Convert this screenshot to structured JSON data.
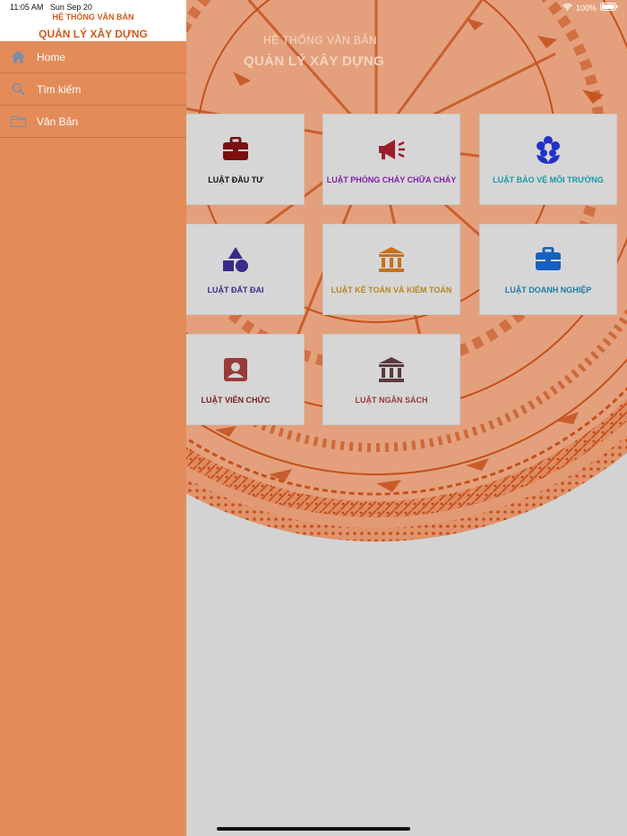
{
  "status_bar": {
    "time": "11:05 AM",
    "date": "Sun Sep 20",
    "battery": "100%"
  },
  "drawer": {
    "subtitle": "HỆ THỐNG VĂN BẢN",
    "title": "QUẢN LÝ XÂY DỰNG",
    "items": [
      {
        "label": "Home",
        "icon": "home-icon"
      },
      {
        "label": "Tìm kiếm",
        "icon": "search-icon"
      },
      {
        "label": "Văn Bản",
        "icon": "folder-icon"
      }
    ]
  },
  "main": {
    "subtitle": "HỆ THỐNG VĂN BẢN",
    "title": "QUẢN LÝ XÂY DỰNG",
    "tiles": [
      {
        "label": "LUẬT ĐẦU TƯ",
        "icon": "briefcase-icon",
        "color": "#7a1010"
      },
      {
        "label": "LUẬT PHÒNG CHÁY CHỮA CHÁY",
        "icon": "megaphone-icon",
        "color": "#7e1fa8"
      },
      {
        "label": "LUẬT BẢO VỆ MÔI TRƯỜNG",
        "icon": "flower-icon",
        "color": "#1a9aa8"
      },
      {
        "label": "LUẬT ĐẤT ĐAI",
        "icon": "shapes-icon",
        "color": "#3a2a8a"
      },
      {
        "label": "LUẬT KẾ TOÁN VÀ KIỂM TOÁN",
        "icon": "bank-icon",
        "color": "#c8701c"
      },
      {
        "label": "LUẬT DOANH NGHIỆP",
        "icon": "briefcase-icon",
        "color": "#1560c0"
      },
      {
        "label": "LUẬT VIÊN CHỨC",
        "icon": "contact-card-icon",
        "color": "#9a3a3a"
      },
      {
        "label": "LUẬT NGÂN SÁCH",
        "icon": "bank-icon",
        "color": "#5a3a40"
      }
    ]
  },
  "colors": {
    "drawer_bg": "#e38c5a",
    "accent": "#d05a1e",
    "tile_bg": "#d6d6d6"
  }
}
